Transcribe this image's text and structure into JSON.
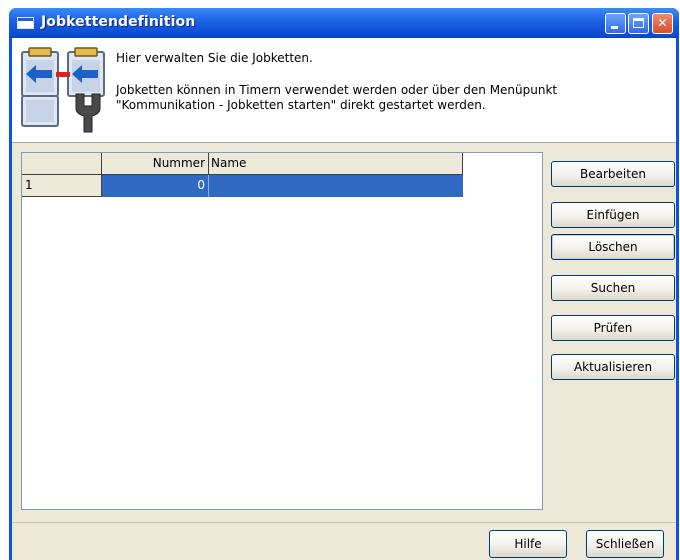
{
  "window": {
    "title": "Jobkettendefinition"
  },
  "header": {
    "line1": "Hier verwalten Sie die Jobketten.",
    "line2": "Jobketten können in Timern verwendet werden oder über den Menüpunkt \"Kommunikation - Jobketten starten\" direkt gestartet werden."
  },
  "grid": {
    "columns": [
      "",
      "Nummer",
      "Name"
    ],
    "rows": [
      {
        "index": "1",
        "nummer": "0",
        "name": ""
      }
    ]
  },
  "side_buttons": {
    "bearbeiten": "Bearbeiten",
    "einfuegen": "Einfügen",
    "loeschen": "Löschen",
    "suchen": "Suchen",
    "pruefen": "Prüfen",
    "aktualisieren": "Aktualisieren"
  },
  "footer": {
    "hilfe": "Hilfe",
    "schliessen": "Schließen"
  }
}
